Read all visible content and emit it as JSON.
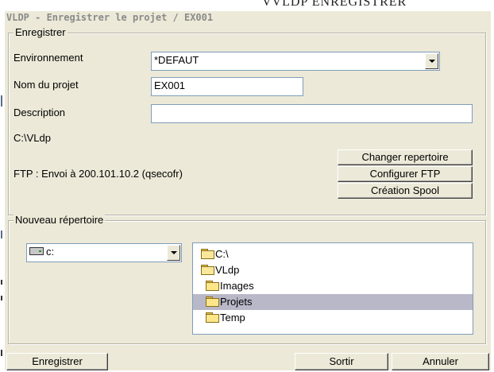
{
  "background": {
    "partial_text": "VVLDP ENREGISTRER"
  },
  "window": {
    "title": "VLDP - Enregistrer le projet / EX001"
  },
  "group_save": {
    "label": "Enregistrer",
    "env_label": "Environnement",
    "env_value": "*DEFAUT",
    "project_label": "Nom du projet",
    "project_value": "EX001",
    "description_label": "Description",
    "description_value": "",
    "path": "C:\\VLdp",
    "ftp_status": "FTP : Envoi à 200.101.10.2 (qsecofr)",
    "buttons": {
      "change_dir": "Changer repertoire",
      "config_ftp": "Configurer FTP",
      "spool": "Création Spool"
    }
  },
  "group_dir": {
    "label": "Nouveau répertoire",
    "drive_value": "c:",
    "tree": [
      {
        "label": "C:\\",
        "icon": "open-folder-icon",
        "selected": false
      },
      {
        "label": "VLdp",
        "icon": "open-folder-icon",
        "selected": false
      },
      {
        "label": "Images",
        "icon": "folder-icon",
        "selected": false
      },
      {
        "label": "Projets",
        "icon": "folder-icon",
        "selected": true
      },
      {
        "label": "Temp",
        "icon": "folder-icon",
        "selected": false
      }
    ]
  },
  "footer": {
    "save": "Enregistrer",
    "exit": "Sortir",
    "cancel": "Annuler"
  }
}
